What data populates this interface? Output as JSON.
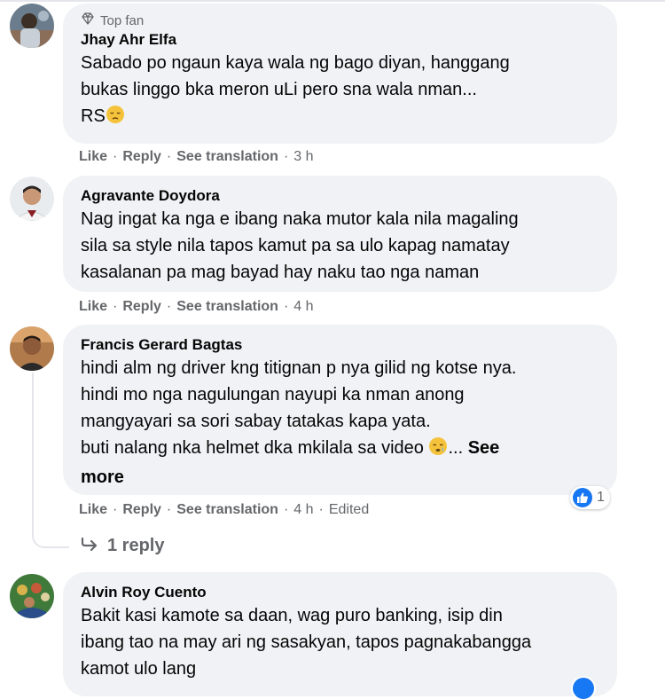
{
  "comments": [
    {
      "badge": "Top fan",
      "author": "Jhay Ahr Elfa",
      "lines": [
        "Sabado po ngaun kaya wala ng bago diyan, hanggang",
        "bukas linggo bka meron uLi pero sna wala nman...",
        "RS"
      ],
      "actions": {
        "like": "Like",
        "reply": "Reply",
        "translate": "See translation",
        "time": "3 h"
      }
    },
    {
      "author": "Agravante Doydora",
      "lines": [
        "Nag ingat ka nga e ibang naka mutor kala nila magaling",
        "sila sa style nila tapos kamut pa sa ulo kapag namatay",
        "kasalanan pa mag bayad hay naku tao nga naman"
      ],
      "actions": {
        "like": "Like",
        "reply": "Reply",
        "translate": "See translation",
        "time": "4 h"
      }
    },
    {
      "author": "Francis Gerard Bagtas",
      "lines": [
        "hindi alm ng driver kng titignan p nya gilid ng kotse nya.",
        "hindi mo nga nagulungan nayupi ka nman anong",
        "mangyayari sa sori sabay tatakas kapa yata.",
        "buti nalang nka helmet dka mkilala sa video"
      ],
      "ellipsis": "...",
      "see_more": "See",
      "see_more_2": "more",
      "reaction_count": "1",
      "actions": {
        "like": "Like",
        "reply": "Reply",
        "translate": "See translation",
        "time": "4 h",
        "edited": "Edited"
      },
      "replies_link": "1 reply"
    },
    {
      "author": "Alvin Roy Cuento",
      "lines": [
        "Bakit kasi kamote sa daan, wag puro banking, isip din",
        "ibang tao na may ari ng sasakyan, tapos pagnakabangga",
        "kamot ulo lang"
      ]
    }
  ],
  "separator": "·",
  "icons": {
    "top_fan": "diamond-icon",
    "emoji_1": "pensive-face-emoji",
    "emoji_2": "sleepy-face-emoji",
    "like_reaction": "thumbs-up-icon",
    "reply_arrow": "reply-arrow-icon"
  },
  "colors": {
    "bubble": "#f0f2f5",
    "meta": "#65676b",
    "like": "#1877f2",
    "text": "#050505"
  }
}
